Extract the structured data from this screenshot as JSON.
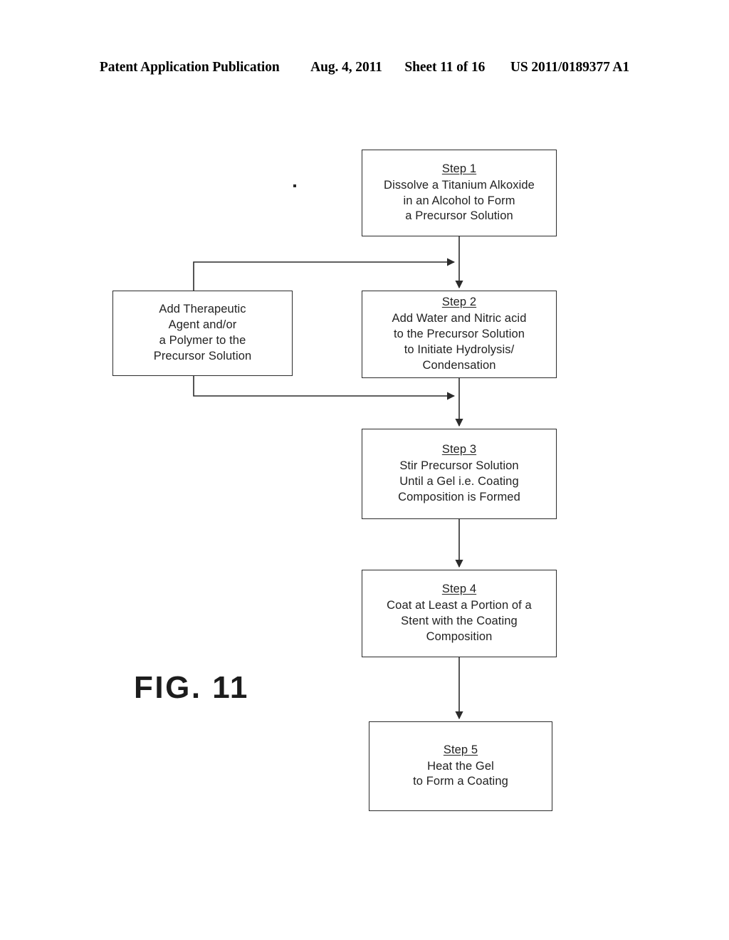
{
  "header": {
    "publication": "Patent Application Publication",
    "date": "Aug. 4, 2011",
    "sheet": "Sheet 11 of 16",
    "patent_number": "US 2011/0189377 A1"
  },
  "figure": {
    "label": "FIG. 11",
    "type": "process-flowchart",
    "ink_color": "#2b2b2b",
    "background": "#ffffff"
  },
  "flowchart": {
    "nodes": [
      {
        "id": "step1",
        "title": "Step 1",
        "lines": [
          "Dissolve a Titanium Alkoxide",
          "in an Alcohol to Form",
          "a Precursor Solution"
        ]
      },
      {
        "id": "side-additive",
        "title": "",
        "lines": [
          "Add Therapeutic",
          "Agent and/or",
          "a Polymer to the",
          "Precursor Solution"
        ]
      },
      {
        "id": "step2",
        "title": "Step 2",
        "lines": [
          "Add Water and Nitric acid",
          "to the Precursor Solution",
          "to Initiate Hydrolysis/",
          "Condensation"
        ]
      },
      {
        "id": "step3",
        "title": "Step 3",
        "lines": [
          "Stir Precursor Solution",
          "Until a Gel i.e. Coating",
          "Composition is Formed"
        ]
      },
      {
        "id": "step4",
        "title": "Step 4",
        "lines": [
          "Coat at Least a Portion of a",
          "Stent with the Coating",
          "Composition"
        ]
      },
      {
        "id": "step5",
        "title": "Step 5",
        "lines": [
          "Heat the Gel",
          "to Form a Coating"
        ]
      }
    ],
    "edges": [
      {
        "from": "step1",
        "to": "step2",
        "kind": "vertical-arrow"
      },
      {
        "from": "side-additive",
        "to": "step1-to-step2-line",
        "kind": "elbow-arrow-up-right"
      },
      {
        "from": "side-additive",
        "to": "step2-to-step3-line",
        "kind": "elbow-arrow-down-right"
      },
      {
        "from": "step2",
        "to": "step3",
        "kind": "vertical-arrow"
      },
      {
        "from": "step3",
        "to": "step4",
        "kind": "vertical-arrow"
      },
      {
        "from": "step4",
        "to": "step5",
        "kind": "vertical-arrow"
      }
    ]
  }
}
